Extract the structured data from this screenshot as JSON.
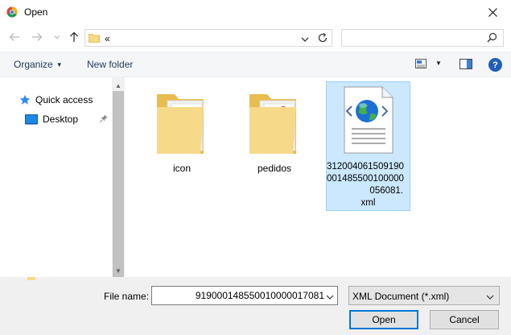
{
  "window": {
    "title": "Open",
    "app_icon": "chrome-icon",
    "close_icon": "close-icon"
  },
  "nav": {
    "back_icon": "back-arrow-icon",
    "forward_icon": "forward-arrow-icon",
    "recent_icon": "chevron-down-icon",
    "up_icon": "up-arrow-icon",
    "address_path": "«",
    "refresh_icon": "refresh-icon",
    "search_placeholder": "",
    "search_icon": "search-icon"
  },
  "toolbar": {
    "organize_label": "Organize",
    "new_folder_label": "New folder",
    "view_icon": "view-options-icon",
    "preview_pane_icon": "preview-pane-icon",
    "help_label": "?"
  },
  "sidebar": {
    "items": [
      {
        "label": "Quick access",
        "icon": "star-icon"
      },
      {
        "label": "Desktop",
        "icon": "desktop-icon",
        "pinned": true
      }
    ]
  },
  "files": [
    {
      "name": "icon",
      "type": "folder"
    },
    {
      "name": "pedidos",
      "type": "folder"
    },
    {
      "name_lines": [
        "312004061509190",
        "001485500100000",
        "056081.",
        "xml"
      ],
      "type": "xml",
      "selected": true
    }
  ],
  "footer": {
    "file_name_label": "File name:",
    "file_name_value": "919000148550010000017081",
    "file_type_value": "XML Document (*.xml)",
    "open_label": "Open",
    "cancel_label": "Cancel"
  },
  "colors": {
    "selection_bg": "#cce8ff",
    "selection_border": "#99d1ff",
    "folder": "#f7d98a",
    "accent": "#0078d7"
  }
}
